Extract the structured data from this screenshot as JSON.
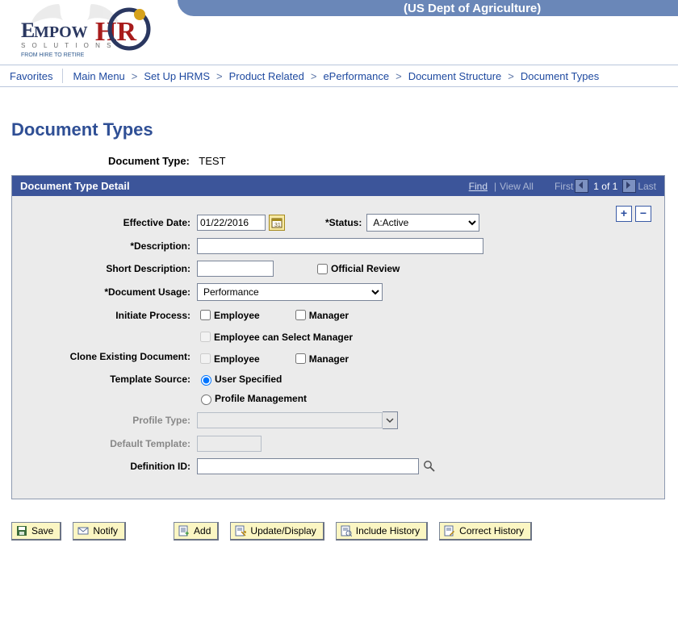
{
  "header": {
    "org_title": "(US Dept of Agriculture)",
    "logo": {
      "primary": "EmpowHR",
      "sub": "SOLUTIONS",
      "tag": "FROM HIRE TO RETIRE"
    }
  },
  "breadcrumbs": {
    "favorites": "Favorites",
    "items": [
      "Main Menu",
      "Set Up HRMS",
      "Product Related",
      "ePerformance",
      "Document Structure",
      "Document Types"
    ]
  },
  "page": {
    "title": "Document Types",
    "doc_type_label": "Document Type:",
    "doc_type_value": "TEST"
  },
  "section": {
    "title": "Document Type Detail",
    "toolbar": {
      "find": "Find",
      "view_all": "View All",
      "first": "First",
      "counter": "1 of 1",
      "last": "Last"
    }
  },
  "form": {
    "effective_date": {
      "label": "Effective Date:",
      "value": "01/22/2016"
    },
    "status": {
      "label": "*Status:",
      "value": "A:Active"
    },
    "description": {
      "label": "*Description:",
      "value": ""
    },
    "short_description": {
      "label": "Short Description:",
      "value": ""
    },
    "official_review": {
      "label": "Official Review",
      "checked": false
    },
    "document_usage": {
      "label": "*Document Usage:",
      "value": "Performance"
    },
    "initiate_process": {
      "label": "Initiate Process:",
      "employee": {
        "label": "Employee",
        "checked": false
      },
      "manager": {
        "label": "Manager",
        "checked": false
      },
      "emp_select_mgr": {
        "label": "Employee can Select Manager",
        "checked": false
      }
    },
    "clone_existing": {
      "label": "Clone Existing Document:",
      "employee": {
        "label": "Employee",
        "checked": false
      },
      "manager": {
        "label": "Manager",
        "checked": false
      }
    },
    "template_source": {
      "label": "Template Source:",
      "user_specified": {
        "label": "User Specified"
      },
      "profile_mgmt": {
        "label": "Profile Management"
      },
      "selected": "user_specified"
    },
    "profile_type": {
      "label": "Profile Type:",
      "value": ""
    },
    "default_template": {
      "label": "Default Template:",
      "value": ""
    },
    "definition_id": {
      "label": "Definition ID:",
      "value": ""
    }
  },
  "buttons": {
    "save": "Save",
    "notify": "Notify",
    "add": "Add",
    "update_display": "Update/Display",
    "include_history": "Include History",
    "correct_history": "Correct History"
  }
}
